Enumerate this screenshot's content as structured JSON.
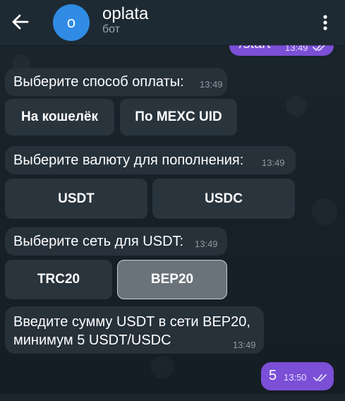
{
  "header": {
    "title": "oplata",
    "subtitle": "бот",
    "avatar_letter": "o"
  },
  "messages": {
    "outgoing_start": {
      "text": "/start",
      "time": "13:49"
    },
    "payment_method": {
      "text": "Выберите способ оплаты:",
      "time": "13:49",
      "buttons": [
        "На кошелёк",
        "По MEXC UID"
      ]
    },
    "currency": {
      "text": "Выберите валюту для пополнения:",
      "time": "13:49",
      "buttons": [
        "USDT",
        "USDC"
      ]
    },
    "network": {
      "text": "Выберите сеть для USDT:",
      "time": "13:49",
      "buttons": [
        "TRC20",
        "BEP20"
      ],
      "selected": "BEP20"
    },
    "amount_prompt": {
      "line1": "Введите сумму USDT в сети BEP20,",
      "line2": "минимум 5 USDT/USDC",
      "time": "13:49"
    },
    "outgoing_amount": {
      "text": "5",
      "time": "13:50"
    }
  },
  "colors": {
    "accent": "#7b4fd6",
    "avatar": "#2f8be4",
    "bubble": "#26313a",
    "header": "#1e2a33"
  }
}
